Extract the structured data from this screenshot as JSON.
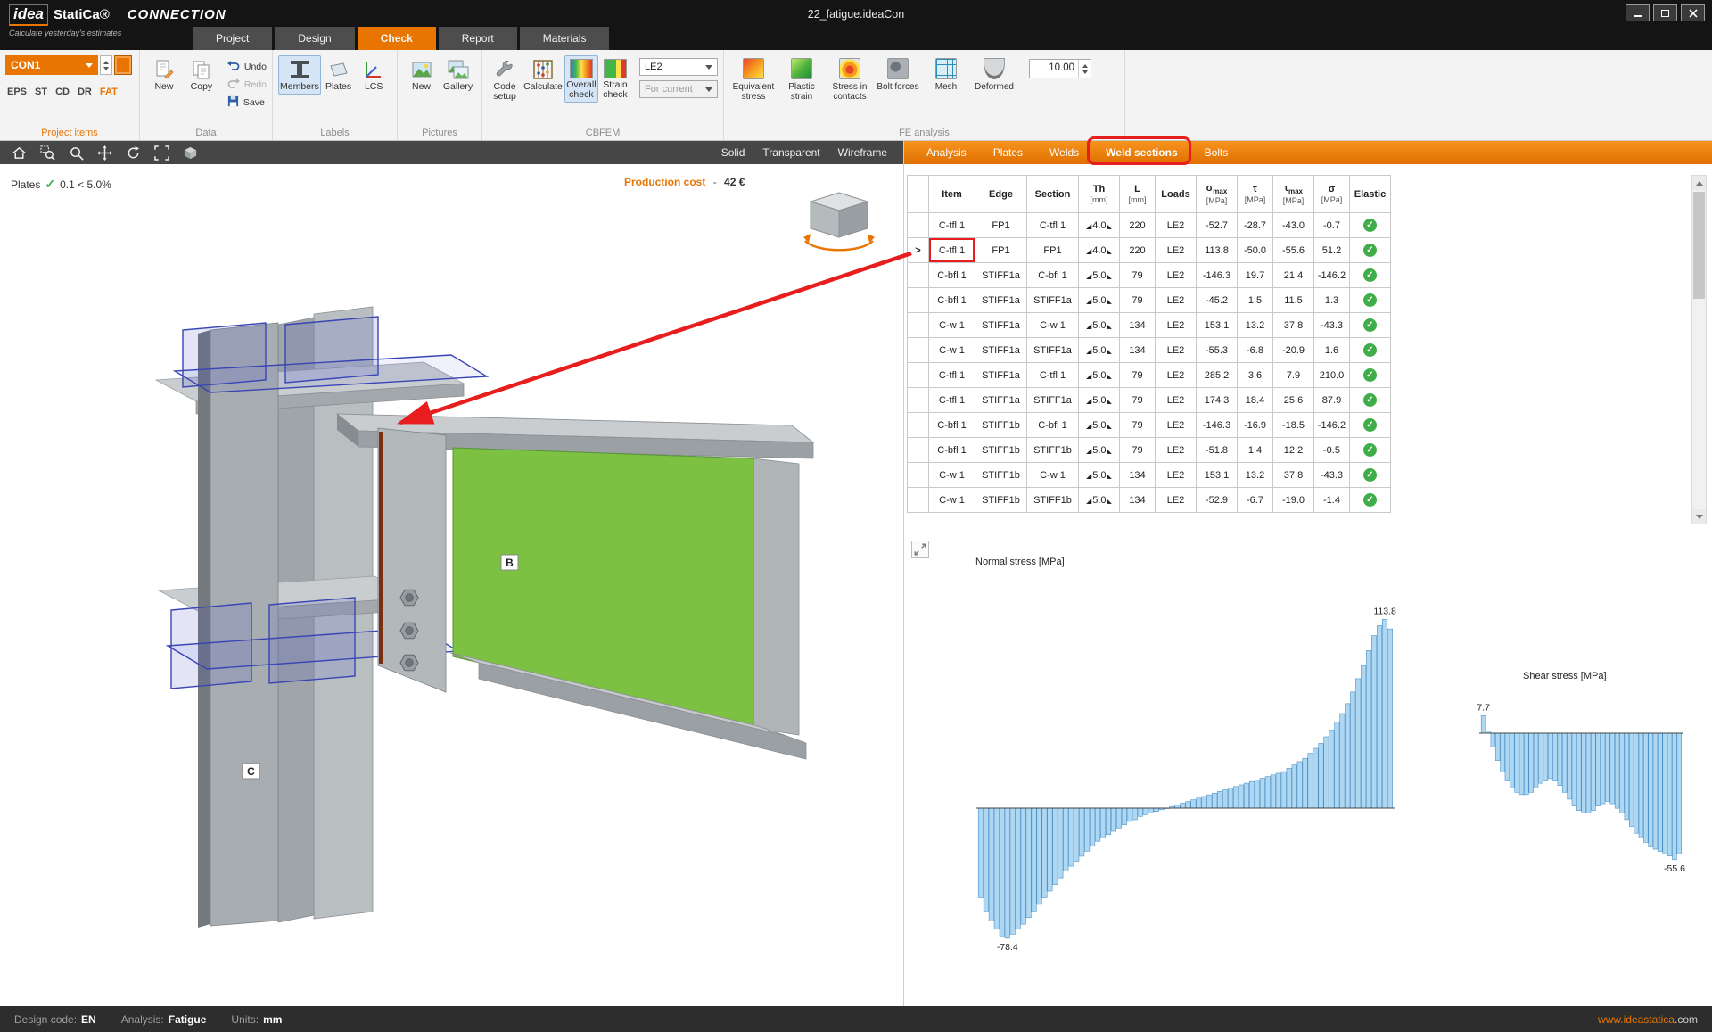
{
  "titlebar": {
    "logo_idea": "idea",
    "logo_statica": "StatiCa®",
    "app_name": "CONNECTION",
    "tagline": "Calculate yesterday's estimates",
    "document_title": "22_fatigue.ideaCon"
  },
  "ribbon_tabs": [
    {
      "label": "Project",
      "active": false
    },
    {
      "label": "Design",
      "active": false
    },
    {
      "label": "Check",
      "active": true
    },
    {
      "label": "Report",
      "active": false
    },
    {
      "label": "Materials",
      "active": false
    }
  ],
  "ribbon": {
    "project_items": {
      "group_label": "Project items",
      "selector_value": "CON1",
      "modes": [
        "EPS",
        "ST",
        "CD",
        "DR",
        "FAT"
      ],
      "active_mode": "FAT"
    },
    "data_group": {
      "group_label": "Data",
      "new_label": "New",
      "copy_label": "Copy",
      "undo_label": "Undo",
      "redo_label": "Redo",
      "save_label": "Save"
    },
    "labels_group": {
      "group_label": "Labels",
      "items": [
        {
          "label": "Members",
          "selected": true
        },
        {
          "label": "Plates",
          "selected": false
        },
        {
          "label": "LCS",
          "selected": false
        }
      ]
    },
    "pictures_group": {
      "group_label": "Pictures",
      "new_label": "New",
      "gallery_label": "Gallery"
    },
    "cbfem_group": {
      "group_label": "CBFEM",
      "code_setup_label": "Code setup",
      "calculate_label": "Calculate",
      "overall_check_label": "Overall check",
      "strain_check_label": "Strain check",
      "load_effect_value": "LE2",
      "scope_value": "For current"
    },
    "fe_group": {
      "group_label": "FE analysis",
      "items": [
        "Equivalent stress",
        "Plastic strain",
        "Stress in contacts",
        "Bolt forces",
        "Mesh",
        "Deformed"
      ],
      "scale_value": "10.00"
    }
  },
  "viewport": {
    "toolbar_icons": [
      "home",
      "zoom-window",
      "zoom",
      "pan",
      "rotate",
      "fit",
      "shaded-box"
    ],
    "view_modes": [
      "Solid",
      "Transparent",
      "Wireframe"
    ],
    "plates_check": {
      "label": "Plates",
      "check_icon": "✓",
      "value": "0.1 < 5.0%"
    },
    "production_cost": {
      "label": "Production cost",
      "separator": "-",
      "value": "42 €"
    },
    "model_labels": {
      "beam": "B",
      "column": "C"
    }
  },
  "results_tabs": [
    {
      "label": "Analysis",
      "highlighted": false
    },
    {
      "label": "Plates",
      "highlighted": false
    },
    {
      "label": "Welds",
      "highlighted": false
    },
    {
      "label": "Weld sections",
      "highlighted": true
    },
    {
      "label": "Bolts",
      "highlighted": false
    }
  ],
  "table": {
    "selected_marker": ">",
    "ok_icon": "✓",
    "weld_prefix_icon": "◢",
    "weld_suffix_icon": "◣",
    "headers": [
      {
        "key": "marker",
        "label": ""
      },
      {
        "key": "item",
        "label": "Item"
      },
      {
        "key": "edge",
        "label": "Edge"
      },
      {
        "key": "section",
        "label": "Section"
      },
      {
        "key": "th",
        "label": "Th",
        "unit": "[mm]"
      },
      {
        "key": "l",
        "label": "L",
        "unit": "[mm]"
      },
      {
        "key": "loads",
        "label": "Loads"
      },
      {
        "key": "sigma_max",
        "label": "σ",
        "sub": "max",
        "unit": "[MPa]"
      },
      {
        "key": "tau",
        "label": "τ",
        "unit": "[MPa]"
      },
      {
        "key": "tau_max",
        "label": "τ",
        "sub": "max",
        "unit": "[MPa]"
      },
      {
        "key": "sigma",
        "label": "σ",
        "unit": "[MPa]"
      },
      {
        "key": "elastic",
        "label": "Elastic"
      }
    ],
    "rows": [
      {
        "selected": false,
        "item": "C-tfl 1",
        "edge": "FP1",
        "section": "C-tfl 1",
        "th": "4.0",
        "l": "220",
        "loads": "LE2",
        "sigma_max": "-52.7",
        "tau": "-28.7",
        "tau_max": "-43.0",
        "sigma": "-0.7",
        "status": "ok"
      },
      {
        "selected": true,
        "item": "C-tfl 1",
        "edge": "FP1",
        "section": "FP1",
        "th": "4.0",
        "l": "220",
        "loads": "LE2",
        "sigma_max": "113.8",
        "tau": "-50.0",
        "tau_max": "-55.6",
        "sigma": "51.2",
        "status": "ok"
      },
      {
        "selected": false,
        "item": "C-bfl 1",
        "edge": "STIFF1a",
        "section": "C-bfl 1",
        "th": "5.0",
        "l": "79",
        "loads": "LE2",
        "sigma_max": "-146.3",
        "tau": "19.7",
        "tau_max": "21.4",
        "sigma": "-146.2",
        "status": "ok"
      },
      {
        "selected": false,
        "item": "C-bfl 1",
        "edge": "STIFF1a",
        "section": "STIFF1a",
        "th": "5.0",
        "l": "79",
        "loads": "LE2",
        "sigma_max": "-45.2",
        "tau": "1.5",
        "tau_max": "11.5",
        "sigma": "1.3",
        "status": "ok"
      },
      {
        "selected": false,
        "item": "C-w 1",
        "edge": "STIFF1a",
        "section": "C-w 1",
        "th": "5.0",
        "l": "134",
        "loads": "LE2",
        "sigma_max": "153.1",
        "tau": "13.2",
        "tau_max": "37.8",
        "sigma": "-43.3",
        "status": "ok"
      },
      {
        "selected": false,
        "item": "C-w 1",
        "edge": "STIFF1a",
        "section": "STIFF1a",
        "th": "5.0",
        "l": "134",
        "loads": "LE2",
        "sigma_max": "-55.3",
        "tau": "-6.8",
        "tau_max": "-20.9",
        "sigma": "1.6",
        "status": "ok"
      },
      {
        "selected": false,
        "item": "C-tfl 1",
        "edge": "STIFF1a",
        "section": "C-tfl 1",
        "th": "5.0",
        "l": "79",
        "loads": "LE2",
        "sigma_max": "285.2",
        "tau": "3.6",
        "tau_max": "7.9",
        "sigma": "210.0",
        "status": "ok"
      },
      {
        "selected": false,
        "item": "C-tfl 1",
        "edge": "STIFF1a",
        "section": "STIFF1a",
        "th": "5.0",
        "l": "79",
        "loads": "LE2",
        "sigma_max": "174.3",
        "tau": "18.4",
        "tau_max": "25.6",
        "sigma": "87.9",
        "status": "ok"
      },
      {
        "selected": false,
        "item": "C-bfl 1",
        "edge": "STIFF1b",
        "section": "C-bfl 1",
        "th": "5.0",
        "l": "79",
        "loads": "LE2",
        "sigma_max": "-146.3",
        "tau": "-16.9",
        "tau_max": "-18.5",
        "sigma": "-146.2",
        "status": "ok"
      },
      {
        "selected": false,
        "item": "C-bfl 1",
        "edge": "STIFF1b",
        "section": "STIFF1b",
        "th": "5.0",
        "l": "79",
        "loads": "LE2",
        "sigma_max": "-51.8",
        "tau": "1.4",
        "tau_max": "12.2",
        "sigma": "-0.5",
        "status": "ok"
      },
      {
        "selected": false,
        "item": "C-w 1",
        "edge": "STIFF1b",
        "section": "C-w 1",
        "th": "5.0",
        "l": "134",
        "loads": "LE2",
        "sigma_max": "153.1",
        "tau": "13.2",
        "tau_max": "37.8",
        "sigma": "-43.3",
        "status": "ok"
      },
      {
        "selected": false,
        "item": "C-w 1",
        "edge": "STIFF1b",
        "section": "STIFF1b",
        "th": "5.0",
        "l": "134",
        "loads": "LE2",
        "sigma_max": "-52.9",
        "tau": "-6.7",
        "tau_max": "-19.0",
        "sigma": "-1.4",
        "status": "ok"
      }
    ]
  },
  "chart_data": [
    {
      "type": "bar",
      "title": "Normal stress [MPa]",
      "max_label": "113.8",
      "min_label": "-78.4",
      "bar_fill": "#aed7f2",
      "bar_stroke": "#4f93c9",
      "ylim": [
        -80,
        120
      ],
      "values": [
        -54,
        -62,
        -68,
        -73,
        -77,
        -78.4,
        -76,
        -73,
        -70,
        -66,
        -62,
        -58,
        -54,
        -50,
        -46,
        -42,
        -38,
        -35,
        -32,
        -29,
        -26,
        -23,
        -20,
        -18,
        -16,
        -14,
        -12,
        -10,
        -8,
        -7,
        -5,
        -4,
        -3,
        -2,
        -1,
        0,
        1,
        2,
        3,
        4,
        5,
        6,
        7,
        8,
        9,
        10,
        11,
        12,
        13,
        14,
        15,
        16,
        17,
        18,
        19,
        20,
        21,
        22,
        24,
        26,
        28,
        30,
        33,
        36,
        39,
        43,
        47,
        52,
        57,
        63,
        70,
        78,
        86,
        95,
        104,
        110,
        113.8,
        108
      ]
    },
    {
      "type": "bar",
      "title": "Shear stress [MPa]",
      "max_label": "7.7",
      "min_label": "-55.6",
      "bar_fill": "#aed7f2",
      "bar_stroke": "#4f93c9",
      "ylim": [
        -60,
        10
      ],
      "values": [
        7.7,
        1,
        -6,
        -12,
        -17,
        -21,
        -24,
        -26,
        -27,
        -27,
        -26,
        -24,
        -22,
        -21,
        -20,
        -21,
        -23,
        -26,
        -29,
        -32,
        -34,
        -35,
        -35,
        -34,
        -32,
        -31,
        -30,
        -31,
        -33,
        -35,
        -38,
        -41,
        -44,
        -46,
        -48,
        -50,
        -51,
        -52,
        -53,
        -54,
        -55.6,
        -53
      ]
    }
  ],
  "statusbar": {
    "design_code_label": "Design code:",
    "design_code": "EN",
    "analysis_label": "Analysis:",
    "analysis": "Fatigue",
    "units_label": "Units:",
    "units": "mm",
    "website_main": "www.ideastatica",
    "website_tld": ".com"
  },
  "colors": {
    "accent": "#e87502",
    "annotation": "#e81d1d",
    "ok_green": "#3fae49",
    "plate_green": "#7cc141"
  }
}
